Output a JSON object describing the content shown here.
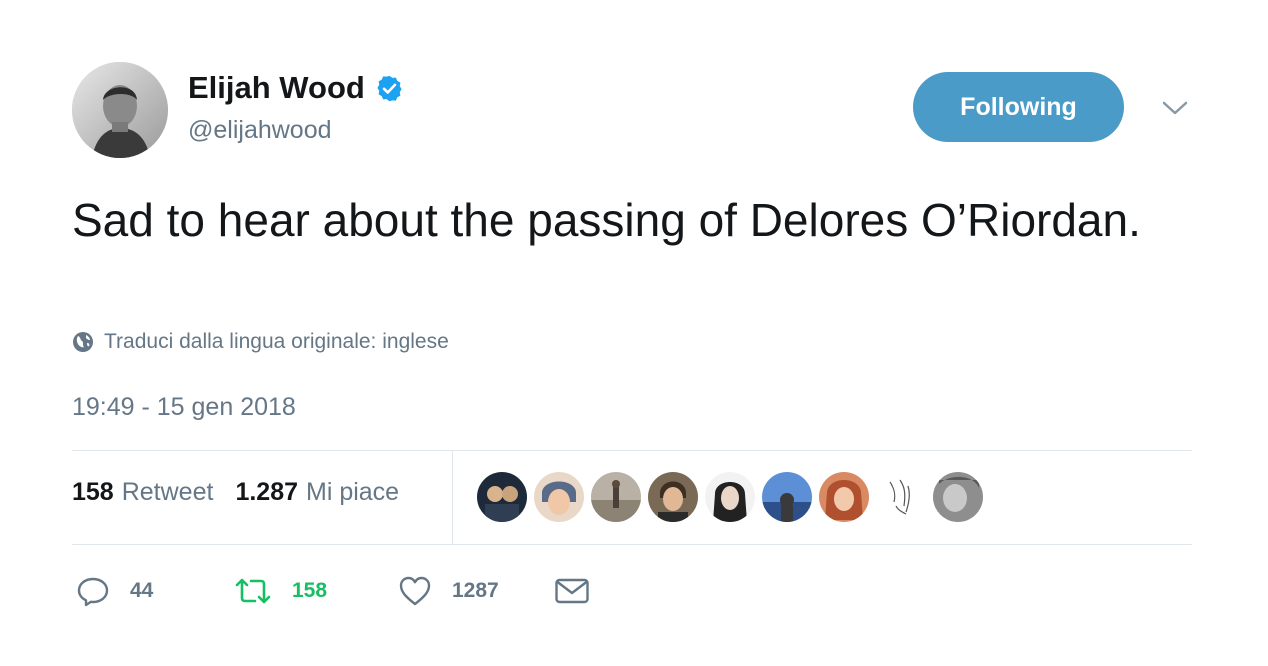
{
  "user": {
    "name": "Elijah Wood",
    "handle": "@elijahwood",
    "verified": true,
    "follow_label": "Following"
  },
  "tweet": {
    "text": "Sad to hear about the passing of Delores O’Riordan.",
    "translate_label": "Traduci dalla lingua originale: inglese",
    "timestamp": "19:49 - 15 gen 2018"
  },
  "stats": {
    "retweets_count": "158",
    "retweets_label": "Retweet",
    "likes_count": "1.287",
    "likes_label": "Mi piace"
  },
  "actions": {
    "reply_count": "44",
    "retweet_count": "158",
    "like_count": "1287"
  },
  "icons": {
    "verified": "verified-badge-icon",
    "caret": "chevron-down-icon",
    "globe": "globe-icon",
    "reply": "reply-icon",
    "retweet": "retweet-icon",
    "like": "heart-icon",
    "dm": "envelope-icon"
  },
  "colors": {
    "follow_button": "#4b9bc8",
    "verified": "#1da1f2",
    "retweet_active": "#17bf63",
    "secondary_text": "#657786",
    "divider": "#e1e8ed"
  }
}
